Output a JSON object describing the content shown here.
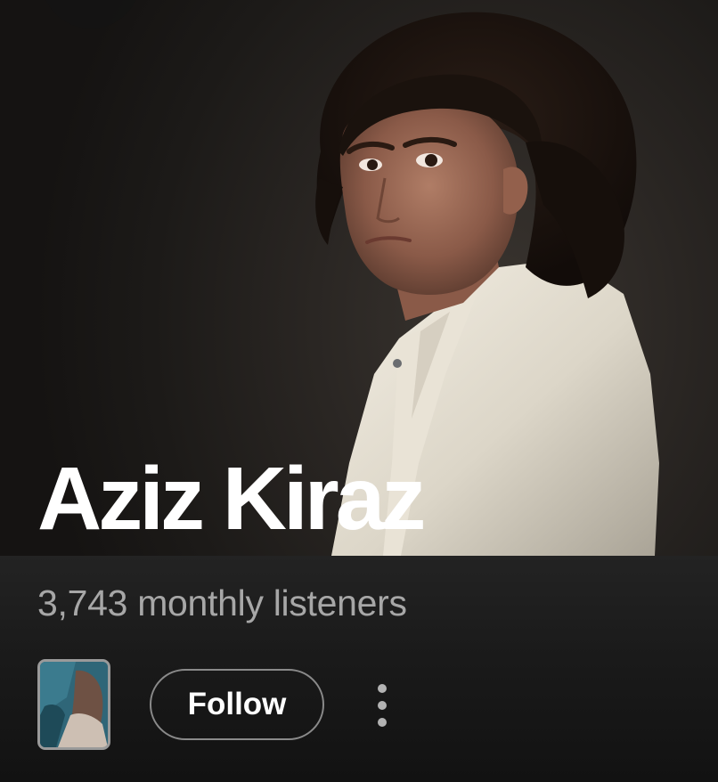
{
  "artist": {
    "name": "Aziz Kiraz",
    "monthly_listeners": "3,743 monthly listeners"
  },
  "actions": {
    "follow_label": "Follow",
    "more_icon": "more-vertical-icon"
  },
  "colors": {
    "background": "#121212",
    "secondary_text": "#a7a7a7",
    "button_border": "#8a8a8a"
  }
}
